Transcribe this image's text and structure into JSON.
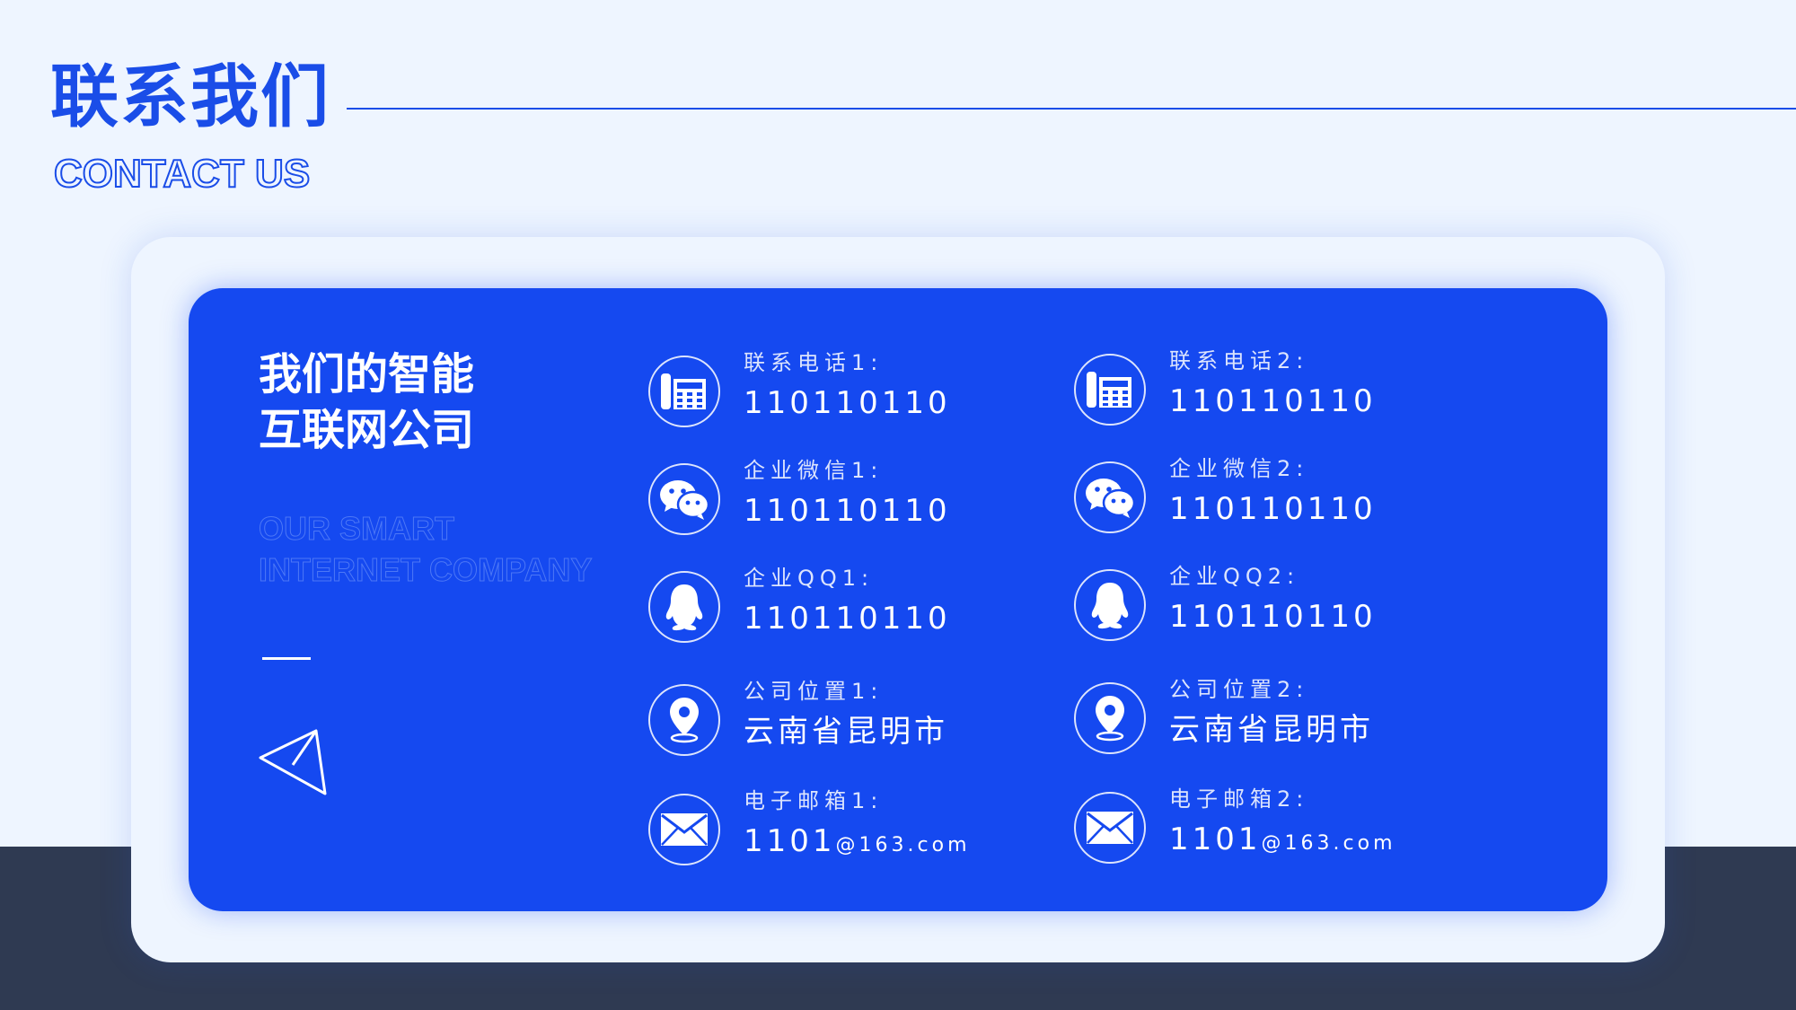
{
  "header": {
    "title_cn": "联系我们",
    "title_en": "CONTACT US"
  },
  "card": {
    "heading_line1": "我们的智能",
    "heading_line2": "互联网公司",
    "subtitle_line1": "OUR SMART",
    "subtitle_line2": "INTERNET COMPANY"
  },
  "contacts": {
    "col1": [
      {
        "label": "联系电话1:",
        "value": "110110110",
        "icon": "telephone-icon"
      },
      {
        "label": "企业微信1:",
        "value": "110110110",
        "icon": "wechat-icon"
      },
      {
        "label": "企业QQ1:",
        "value": "110110110",
        "icon": "qq-icon"
      },
      {
        "label": "公司位置1:",
        "value": "云南省昆明市",
        "icon": "location-pin-icon"
      },
      {
        "label": "电子邮箱1:",
        "value": "1101",
        "value_suffix": "@163.com",
        "icon": "mail-icon"
      }
    ],
    "col2": [
      {
        "label": "联系电话2:",
        "value": "110110110",
        "icon": "telephone-icon"
      },
      {
        "label": "企业微信2:",
        "value": "110110110",
        "icon": "wechat-icon"
      },
      {
        "label": "企业QQ2:",
        "value": "110110110",
        "icon": "qq-icon"
      },
      {
        "label": "公司位置2:",
        "value": "云南省昆明市",
        "icon": "location-pin-icon"
      },
      {
        "label": "电子邮箱2:",
        "value": "1101",
        "value_suffix": "@163.com",
        "icon": "mail-icon"
      }
    ]
  },
  "colors": {
    "accent": "#1a4de8",
    "card_blue": "#1549f0",
    "page_bg": "#eef5ff",
    "dark_band": "#2f3a52"
  }
}
